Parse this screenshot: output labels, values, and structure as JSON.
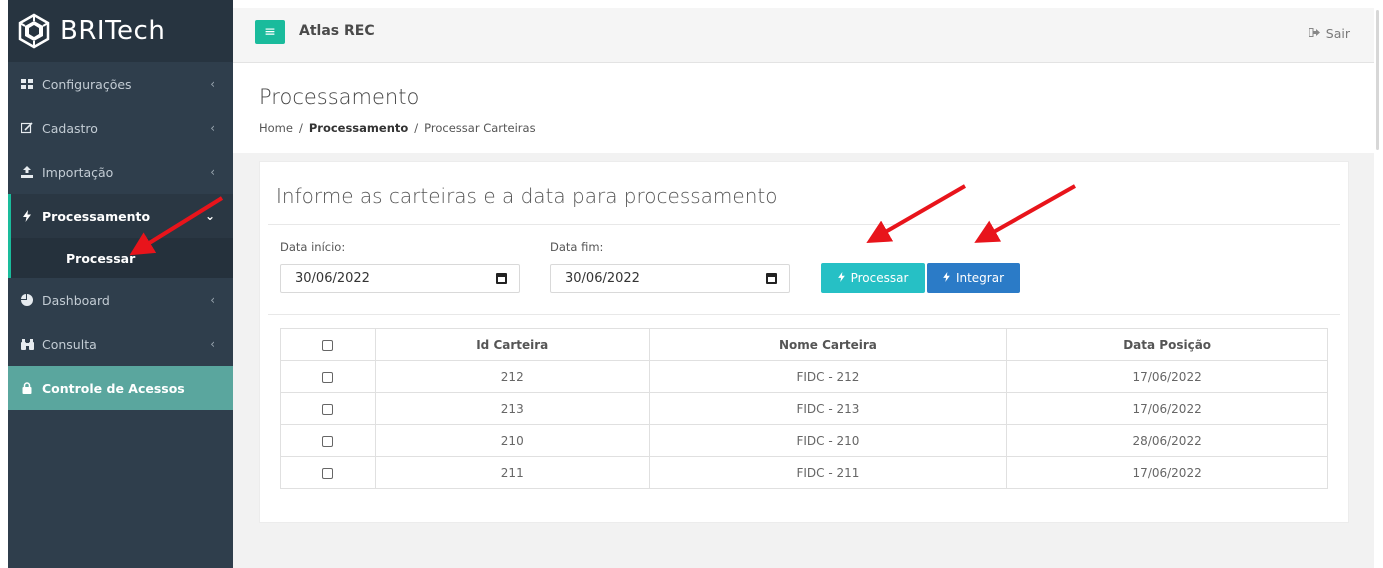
{
  "brand": {
    "name": "BRITech"
  },
  "sidebar": {
    "items": [
      {
        "label": "Configurações",
        "icon": "grid-icon"
      },
      {
        "label": "Cadastro",
        "icon": "edit-icon"
      },
      {
        "label": "Importação",
        "icon": "upload-icon"
      },
      {
        "label": "Processamento",
        "icon": "bolt-icon",
        "expanded": true
      },
      {
        "label": "Dashboard",
        "icon": "pie-chart-icon"
      },
      {
        "label": "Consulta",
        "icon": "binoculars-icon"
      },
      {
        "label": "Controle de Acessos",
        "icon": "lock-icon",
        "active": true
      }
    ],
    "submenu": {
      "label": "Processar"
    },
    "chevron_collapsed": "‹",
    "chevron_expanded": "⌄"
  },
  "topbar": {
    "menu_icon": "≡",
    "title": "Atlas REC",
    "logout_label": "Sair"
  },
  "page": {
    "title": "Processamento",
    "breadcrumb": {
      "home": "Home",
      "section": "Processamento",
      "current": "Processar Carteiras",
      "sep": "/"
    }
  },
  "panel": {
    "title": "Informe as carteiras e a data para processamento",
    "date_start": {
      "label": "Data início:",
      "value": "30/06/2022"
    },
    "date_end": {
      "label": "Data fim:",
      "value": "30/06/2022"
    },
    "processar_label": "Processar",
    "integrar_label": "Integrar"
  },
  "table": {
    "headers": [
      "Id Carteira",
      "Nome Carteira",
      "Data Posição"
    ],
    "rows": [
      {
        "id": "212",
        "nome": "FIDC - 212",
        "data": "17/06/2022"
      },
      {
        "id": "213",
        "nome": "FIDC - 213",
        "data": "17/06/2022"
      },
      {
        "id": "210",
        "nome": "FIDC - 210",
        "data": "28/06/2022"
      },
      {
        "id": "211",
        "nome": "FIDC - 211",
        "data": "17/06/2022"
      }
    ]
  },
  "colors": {
    "sidebar_bg": "#2f3e4c",
    "accent": "#1abb9c",
    "active_menu": "#5aa69e",
    "processar_btn": "#26c0c5",
    "integrar_btn": "#2b7bc7",
    "arrow": "#e8141b"
  }
}
